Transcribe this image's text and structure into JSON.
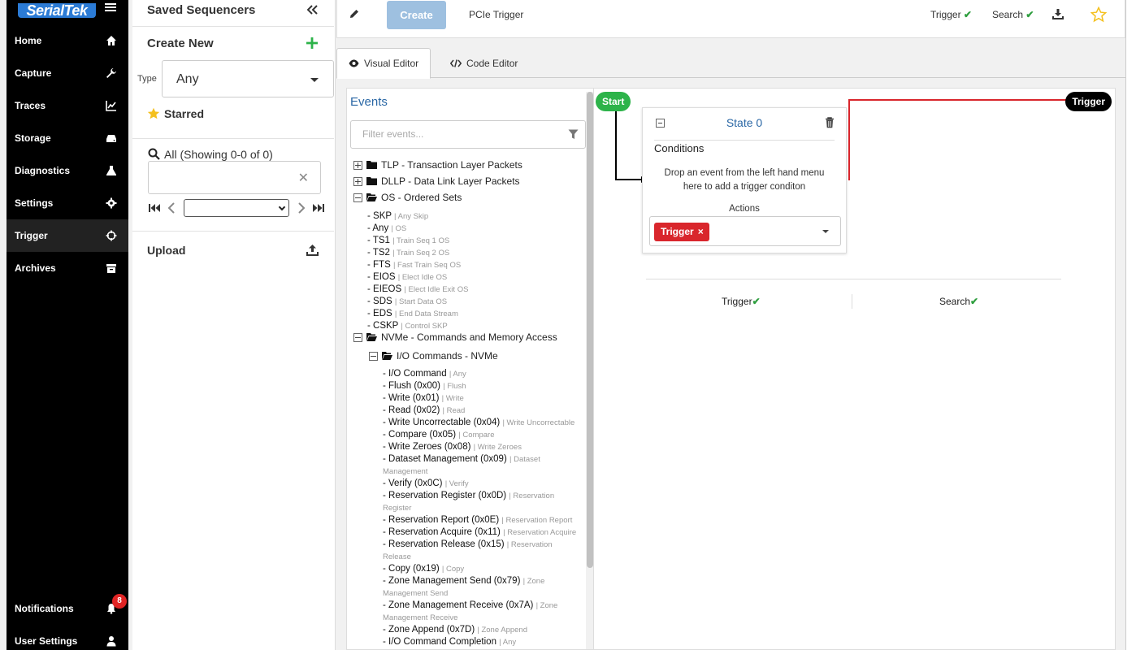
{
  "brand": {
    "logo_text": "SerialTek"
  },
  "nav": {
    "items": [
      {
        "label": "Home",
        "icon": "home-icon"
      },
      {
        "label": "Capture",
        "icon": "wrench-icon"
      },
      {
        "label": "Traces",
        "icon": "chart-icon"
      },
      {
        "label": "Storage",
        "icon": "drive-icon"
      },
      {
        "label": "Diagnostics",
        "icon": "flask-icon"
      },
      {
        "label": "Settings",
        "icon": "gear-icon"
      },
      {
        "label": "Trigger",
        "icon": "crosshair-icon"
      },
      {
        "label": "Archives",
        "icon": "archive-icon"
      }
    ],
    "active": "Trigger",
    "notifications": {
      "label": "Notifications",
      "count": "8"
    },
    "user_settings": {
      "label": "User Settings"
    }
  },
  "sequencers": {
    "title": "Saved Sequencers",
    "create_new": "Create New",
    "type_label": "Type",
    "type_value": "Any",
    "starred": "Starred",
    "all_label": "All (Showing 0-0 of 0)",
    "upload": "Upload"
  },
  "toolbar": {
    "create_label": "Create",
    "sequence_name": "PCIe Trigger",
    "trigger_status": "Trigger",
    "search_status": "Search"
  },
  "tabs": [
    {
      "label": "Visual Editor",
      "active": true
    },
    {
      "label": "Code Editor",
      "active": false
    }
  ],
  "events": {
    "title": "Events",
    "filter_placeholder": "Filter events...",
    "groups": [
      {
        "label": "TLP - Transaction Layer Packets",
        "expanded": false
      },
      {
        "label": "DLLP - Data Link Layer Packets",
        "expanded": false
      },
      {
        "label": "OS - Ordered Sets",
        "expanded": true
      }
    ],
    "os_items": [
      {
        "name": "- SKP",
        "desc": "| Any Skip"
      },
      {
        "name": "- Any",
        "desc": "| OS"
      },
      {
        "name": "- TS1",
        "desc": "| Train Seq 1 OS"
      },
      {
        "name": "- TS2",
        "desc": "| Train Seq 2 OS"
      },
      {
        "name": "- FTS",
        "desc": "| Fast Train Seq OS"
      },
      {
        "name": "- EIOS",
        "desc": "| Elect Idle OS"
      },
      {
        "name": "- EIEOS",
        "desc": "| Elect Idle Exit OS"
      },
      {
        "name": "- SDS",
        "desc": "| Start Data OS"
      },
      {
        "name": "- EDS",
        "desc": "| End Data Stream"
      },
      {
        "name": "- CSKP",
        "desc": "| Control SKP"
      }
    ],
    "nvme_group": "NVMe - Commands and Memory Access",
    "io_group": "I/O Commands - NVMe",
    "io_items": [
      {
        "name": "- I/O Command",
        "desc": "| Any"
      },
      {
        "name": "- Flush (0x00)",
        "desc": "| Flush"
      },
      {
        "name": "- Write (0x01)",
        "desc": "| Write"
      },
      {
        "name": "- Read (0x02)",
        "desc": "| Read"
      },
      {
        "name": "- Write Uncorrectable (0x04)",
        "desc": "| Write Uncorrectable"
      },
      {
        "name": "- Compare (0x05)",
        "desc": "| Compare"
      },
      {
        "name": "- Write Zeroes (0x08)",
        "desc": "| Write Zeroes"
      },
      {
        "name": "- Dataset Management (0x09)",
        "desc": "| Dataset Management"
      },
      {
        "name": "- Verify (0x0C)",
        "desc": "| Verify"
      },
      {
        "name": "- Reservation Register (0x0D)",
        "desc": "| Reservation Register"
      },
      {
        "name": "- Reservation Report (0x0E)",
        "desc": "| Reservation Report"
      },
      {
        "name": "- Reservation Acquire (0x11)",
        "desc": "| Reservation Acquire"
      },
      {
        "name": "- Reservation Release (0x15)",
        "desc": "| Reservation Release"
      },
      {
        "name": "- Copy (0x19)",
        "desc": "| Copy"
      },
      {
        "name": "- Zone Management Send (0x79)",
        "desc": "| Zone Management Send"
      },
      {
        "name": "- Zone Management Receive (0x7A)",
        "desc": "| Zone Management Receive"
      },
      {
        "name": "- Zone Append (0x7D)",
        "desc": "| Zone Append"
      },
      {
        "name": "- I/O Command Completion",
        "desc": "| Any"
      }
    ]
  },
  "canvas": {
    "start_label": "Start",
    "trigger_label": "Trigger",
    "state": {
      "title": "State 0",
      "conditions_label": "Conditions",
      "drop_hint": "Drop an event from the left hand menu here to add a trigger conditon",
      "actions_label": "Actions",
      "action_tag": "Trigger"
    },
    "status_trigger": "Trigger",
    "status_search": "Search"
  },
  "colors": {
    "accent_blue": "#2a67a5",
    "success_green": "#2db34a",
    "danger_red": "#d9262c",
    "create_disabled": "#9ec0e0"
  }
}
